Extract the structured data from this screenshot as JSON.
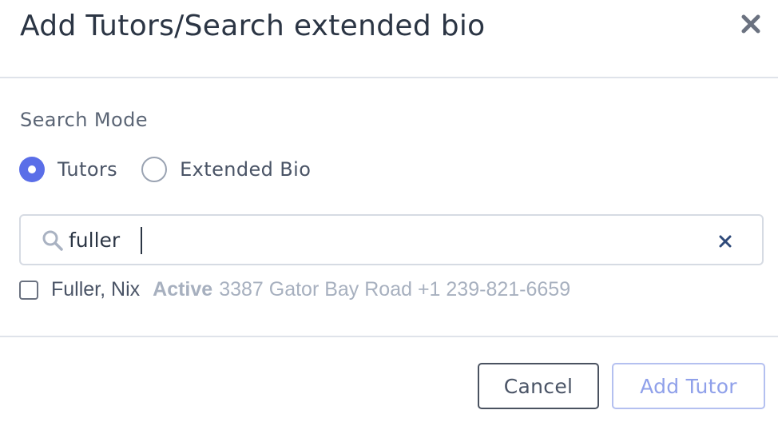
{
  "dialog": {
    "title": "Add Tutors/Search extended bio"
  },
  "search_mode": {
    "label": "Search Mode",
    "options": [
      {
        "label": "Tutors",
        "selected": true
      },
      {
        "label": "Extended Bio",
        "selected": false
      }
    ]
  },
  "search": {
    "value": "fuller",
    "placeholder": ""
  },
  "results": [
    {
      "name": "Fuller, Nix",
      "status": "Active",
      "detail": "3387 Gator Bay Road +1 239-821-6659",
      "checked": false
    }
  ],
  "footer": {
    "cancel_label": "Cancel",
    "add_label": "Add Tutor"
  },
  "colors": {
    "accent": "#5a6ee8",
    "title": "#2b3544",
    "muted": "#a7b0bf"
  }
}
